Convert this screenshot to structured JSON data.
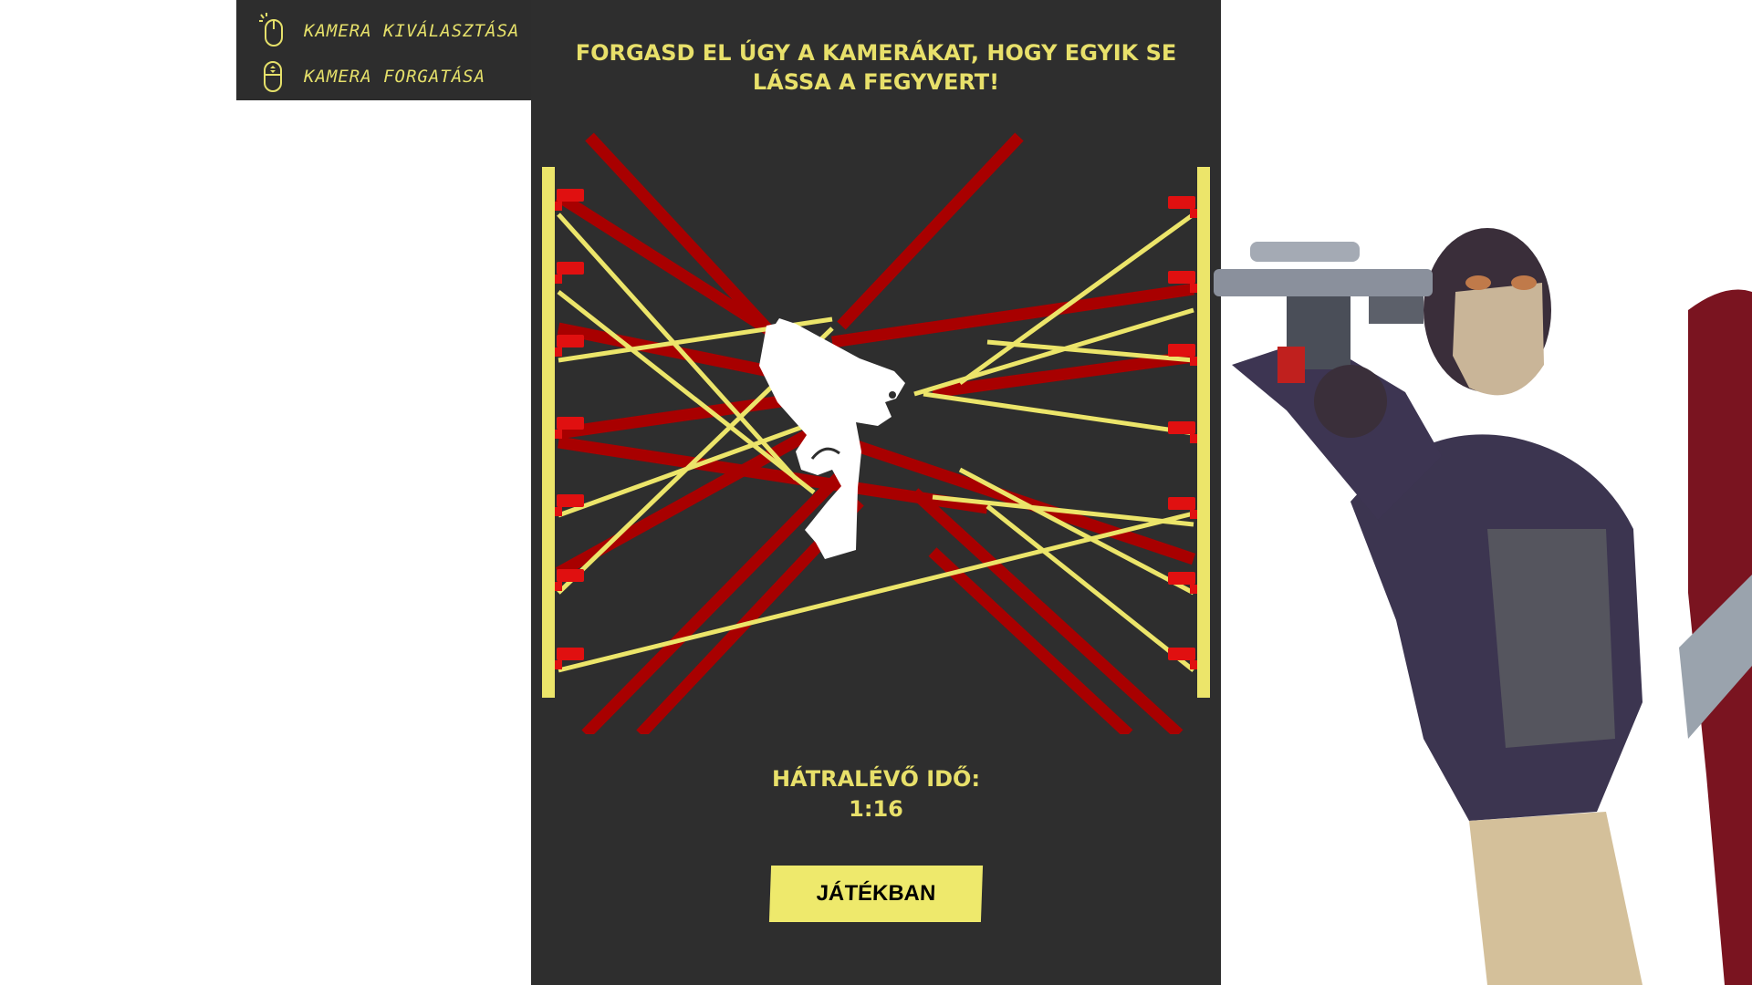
{
  "controls": [
    {
      "icon": "mouse-left-click-icon",
      "label": "KAMERA KIVÁLASZTÁSA"
    },
    {
      "icon": "mouse-scroll-icon",
      "label": "KAMERA FORGATÁSA"
    }
  ],
  "instruction": "FORGASD EL ÚGY A KAMERÁKAT, HOGY EGYIK SE LÁSSA A FEGYVERT!",
  "timer": {
    "label": "HÁTRALÉVŐ IDŐ:",
    "value": "1:16"
  },
  "status_button": "JÁTÉKBAN",
  "colors": {
    "panel": "#2e2e2e",
    "accent_yellow": "#e8e06a",
    "beam_red": "#a80000",
    "beam_yellow": "#ece56a",
    "camera_red": "#e01010",
    "weapon": "#ffffff"
  },
  "cameras": {
    "left_count": 7,
    "right_count": 7
  },
  "weapon_icon": "pistol-icon",
  "character": "masked-soldier-with-rifle"
}
